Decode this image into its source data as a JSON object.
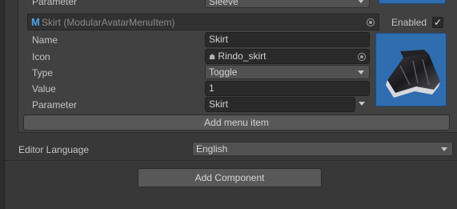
{
  "prev_item": {
    "parameter_label": "Parameter",
    "parameter_value": "Sleeve"
  },
  "menu_item": {
    "header_title": "Skirt (ModularAvatarMenuItem)",
    "enabled_label": "Enabled",
    "enabled_check": "✓",
    "fields": {
      "name_label": "Name",
      "name_value": "Skirt",
      "icon_label": "Icon",
      "icon_value": "Rindo_skirt",
      "type_label": "Type",
      "type_value": "Toggle",
      "value_label": "Value",
      "value_value": "1",
      "parameter_label": "Parameter",
      "parameter_value": "Skirt"
    }
  },
  "add_menu_item_label": "Add menu item",
  "editor_language": {
    "label": "Editor Language",
    "value": "English"
  },
  "add_component_label": "Add Component",
  "colors": {
    "preview_bg": "#2f6db0",
    "panel_bg": "#414141",
    "window_bg": "#383838"
  }
}
